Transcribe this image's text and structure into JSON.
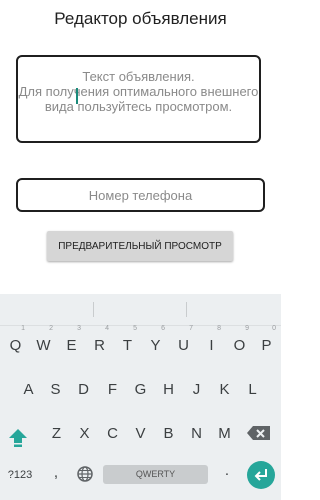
{
  "screen": {
    "title": "Редактор объявления"
  },
  "ad_field": {
    "placeholder": "Текст объявления.\nДля получения оптимального внешнего вида пользуйтесь просмотром."
  },
  "phone_field": {
    "placeholder": "Номер телефона"
  },
  "preview_button": {
    "label": "ПРЕДВАРИТЕЛЬНЫЙ ПРОСМОТР"
  },
  "keyboard": {
    "row1": [
      {
        "key": "Q",
        "hint": "1"
      },
      {
        "key": "W",
        "hint": "2"
      },
      {
        "key": "E",
        "hint": "3"
      },
      {
        "key": "R",
        "hint": "4"
      },
      {
        "key": "T",
        "hint": "5"
      },
      {
        "key": "Y",
        "hint": "6"
      },
      {
        "key": "U",
        "hint": "7"
      },
      {
        "key": "I",
        "hint": "8"
      },
      {
        "key": "O",
        "hint": "9"
      },
      {
        "key": "P",
        "hint": "0"
      }
    ],
    "row2": [
      "A",
      "S",
      "D",
      "F",
      "G",
      "H",
      "J",
      "K",
      "L"
    ],
    "row3": [
      "Z",
      "X",
      "C",
      "V",
      "B",
      "N",
      "M"
    ],
    "symbols_label": "?123",
    "comma_label": ",",
    "space_label": "QWERTY",
    "period_label": ".",
    "accent_color": "#26a69a",
    "icons": {
      "shift": "shift-arrow-icon",
      "backspace": "backspace-icon",
      "globe": "globe-icon",
      "enter": "enter-return-icon"
    }
  }
}
